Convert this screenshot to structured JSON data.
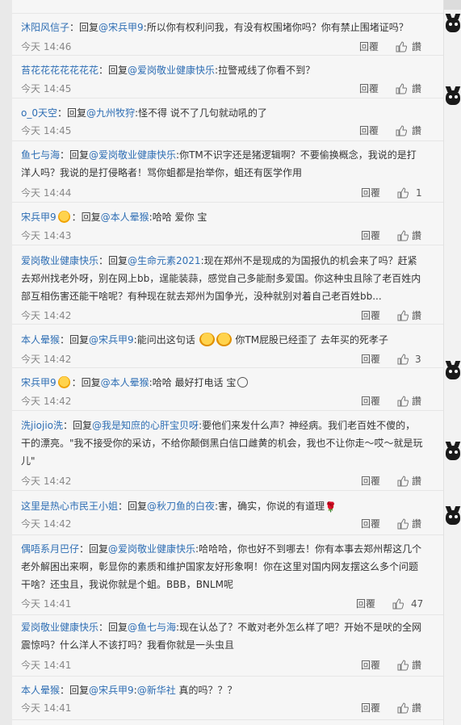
{
  "comments": [
    {
      "user": "沐阳风信子",
      "reply_prefix": "：回复",
      "mention": "@宋兵甲9",
      "content": ":所以你有权利问我，有没有权围堵你吗？你有禁止围堵证吗？",
      "time": "今天 14:46",
      "reply_label": "回覆",
      "like_label": "讚"
    },
    {
      "user": "苔花花花花花花花",
      "reply_prefix": "：回复",
      "mention": "@爱岗敬业健康快乐",
      "content": ":拉警戒线了你看不到？",
      "time": "今天 14:45",
      "reply_label": "回覆",
      "like_label": "讚"
    },
    {
      "user": "o_0天空",
      "reply_prefix": "：回复",
      "mention": "@九州牧狩",
      "content": ":怪不得 说不了几句就动吼的了",
      "time": "今天 14:45",
      "reply_label": "回覆",
      "like_label": "讚"
    },
    {
      "user": "鱼七与海",
      "reply_prefix": "：回复",
      "mention": "@爱岗敬业健康快乐",
      "content": ":你TM不识字还是猪逻辑啊？不要偷换概念，我说的是打洋人吗？我说的是打侵略者！骂你蛆都是抬举你，蛆还有医学作用",
      "time": "今天 14:44",
      "reply_label": "回覆",
      "like_label": "1"
    },
    {
      "user": "宋兵甲9",
      "reply_prefix": "：回复",
      "mention": "@本人晕猴",
      "content": ":哈哈 爱你  宝",
      "time": "今天 14:43",
      "reply_label": "回覆",
      "like_label": "讚"
    },
    {
      "user": "爱岗敬业健康快乐",
      "reply_prefix": "：回复",
      "mention": "@生命元素2021",
      "content": ":现在郑州不是现成的为国报仇的机会来了吗？赶紧去郑州找老外呀，别在网上bb，逞能装蒜，感觉自己多能耐多爱国。你这种虫且除了老百姓内部互相伤害还能干啥呢？有种现在就去郑州为国争光，没种就别对着自己老百姓bb...",
      "time": "今天 14:42",
      "reply_label": "回覆",
      "like_label": "讚"
    },
    {
      "user": "本人晕猴",
      "reply_prefix": "：回复",
      "mention": "@宋兵甲9",
      "content": ":能问出这句话",
      "content2": " 你TM屁股已经歪了    去年买的死孝子",
      "time": "今天 14:42",
      "reply_label": "回覆",
      "like_label": "3"
    },
    {
      "user": "宋兵甲9",
      "reply_prefix": "：回复",
      "mention": "@本人晕猴",
      "content": ":哈哈 最好打电话 宝",
      "time": "今天 14:42",
      "reply_label": "回覆",
      "like_label": "讚"
    },
    {
      "user": "洗jiojio洗",
      "reply_prefix": "：回复",
      "mention": "@我是知庶的心肝宝贝呀",
      "content": ":要他们来发什么声？神经病。我们老百姓不傻的，干的漂亮。\"我不接受你的采访，不给你颠倒黑白信口雌黄的机会，我也不让你走～哎～就是玩儿\"",
      "time": "今天 14:42",
      "reply_label": "回覆",
      "like_label": "讚"
    },
    {
      "user": "这里是热心市民王小姐",
      "reply_prefix": "：回复",
      "mention": "@秋刀鱼的白夜",
      "content": ":害，确实，你说的有道理",
      "time": "今天 14:42",
      "reply_label": "回覆",
      "like_label": "讚"
    },
    {
      "user": "偶唔系月巴仔",
      "reply_prefix": "：回复",
      "mention": "@爱岗敬业健康快乐",
      "content": ":哈哈哈，你也好不到哪去！你有本事去郑州帮这几个老外解困出来啊，彰显你的素质和维护国家友好形象啊！你在这里对国内网友摆这么多个问题干啥？还虫且，我说你就是个蛆。BBB，BNLM呢",
      "time": "今天 14:41",
      "reply_label": "回覆",
      "like_label": "47"
    },
    {
      "user": "爱岗敬业健康快乐",
      "reply_prefix": "：回复",
      "mention": "@鱼七与海",
      "content": ":现在认怂了？不敢对老外怎么样了吧？开始不是吠的全网震惊吗？什么洋人不该打吗？我看你就是一头虫且",
      "time": "今天 14:41",
      "reply_label": "回覆",
      "like_label": "讚"
    },
    {
      "user": "本人晕猴",
      "reply_prefix": "：回复",
      "mention": "@宋兵甲9",
      "content": ":",
      "mention2": "@新华社",
      "content2": "  真的吗？？？",
      "time": "今天 14:41",
      "reply_label": "回覆",
      "like_label": "讚"
    }
  ]
}
